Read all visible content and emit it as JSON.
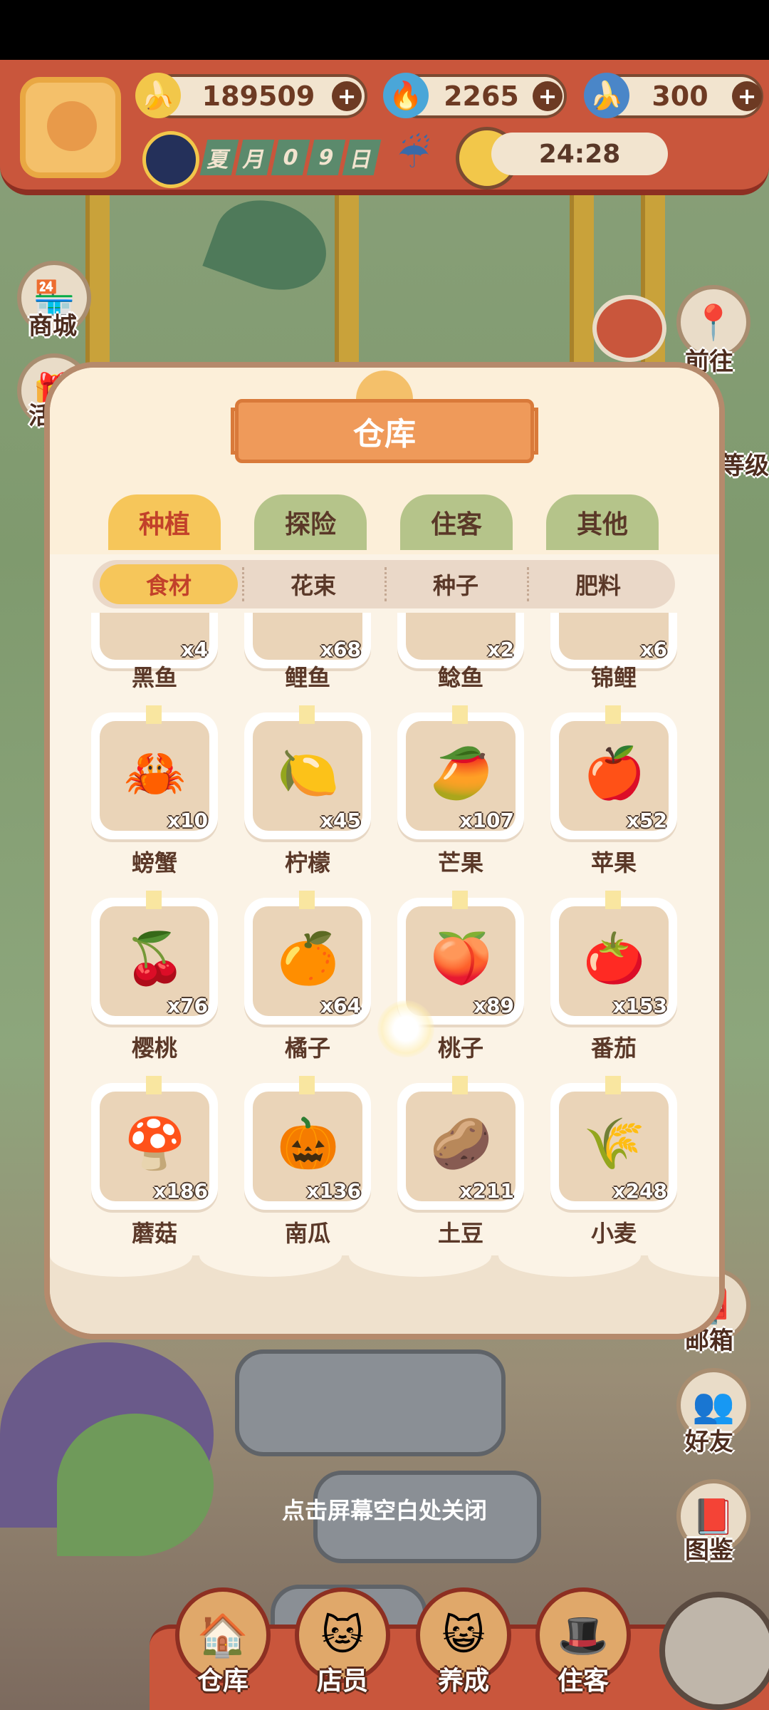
{
  "hud": {
    "resources": [
      {
        "icon": "banana-icon",
        "value": "189509"
      },
      {
        "icon": "blue-flame-icon",
        "value": "2265"
      },
      {
        "icon": "blue-banana-icon",
        "value": "300"
      }
    ],
    "date": {
      "season": "夏",
      "month_char": "月",
      "d1": "0",
      "d2": "9",
      "day_char": "日"
    },
    "timer": "24:28",
    "plus": "+"
  },
  "side_left": [
    {
      "label": "商城",
      "icon": "shop-icon"
    },
    {
      "label": "活动",
      "icon": "gift-icon"
    }
  ],
  "side_right": [
    {
      "label": "前往",
      "icon": "map-pin-icon"
    },
    {
      "label": "等级",
      "icon": "level-icon"
    },
    {
      "label": "邮箱",
      "icon": "mailbox-icon"
    },
    {
      "label": "好友",
      "icon": "friends-icon"
    },
    {
      "label": "图鉴",
      "icon": "book-icon"
    }
  ],
  "dialog": {
    "title": "仓库",
    "tabs": [
      "种植",
      "探险",
      "住客",
      "其他"
    ],
    "active_tab": 0,
    "subtabs": [
      "食材",
      "花束",
      "种子",
      "肥料"
    ],
    "active_subtab": 0,
    "partial_row": [
      {
        "name": "黑鱼",
        "qty": "x4"
      },
      {
        "name": "鲤鱼",
        "qty": "x68"
      },
      {
        "name": "鲶鱼",
        "qty": "x2"
      },
      {
        "name": "锦鲤",
        "qty": "x6"
      }
    ],
    "rows": [
      [
        {
          "name": "螃蟹",
          "qty": "x10",
          "icon": "crab-icon",
          "glyph": "🦀"
        },
        {
          "name": "柠檬",
          "qty": "x45",
          "icon": "lemon-icon",
          "glyph": "🍋"
        },
        {
          "name": "芒果",
          "qty": "x107",
          "icon": "mango-icon",
          "glyph": "🥭"
        },
        {
          "name": "苹果",
          "qty": "x52",
          "icon": "apple-icon",
          "glyph": "🍎"
        }
      ],
      [
        {
          "name": "樱桃",
          "qty": "x76",
          "icon": "cherry-icon",
          "glyph": "🍒"
        },
        {
          "name": "橘子",
          "qty": "x64",
          "icon": "tangerine-icon",
          "glyph": "🍊"
        },
        {
          "name": "桃子",
          "qty": "x89",
          "icon": "peach-icon",
          "glyph": "🍑"
        },
        {
          "name": "番茄",
          "qty": "x153",
          "icon": "tomato-icon",
          "glyph": "🍅"
        }
      ],
      [
        {
          "name": "蘑菇",
          "qty": "x186",
          "icon": "mushroom-icon",
          "glyph": "🍄"
        },
        {
          "name": "南瓜",
          "qty": "x136",
          "icon": "pumpkin-icon",
          "glyph": "🎃"
        },
        {
          "name": "土豆",
          "qty": "x211",
          "icon": "potato-icon",
          "glyph": "🥔"
        },
        {
          "name": "小麦",
          "qty": "x248",
          "icon": "wheat-icon",
          "glyph": "🌾"
        }
      ]
    ]
  },
  "close_hint": "点击屏幕空白处关闭",
  "bottom_nav": [
    {
      "label": "仓库",
      "icon": "warehouse-icon"
    },
    {
      "label": "店员",
      "icon": "cat-staff-icon"
    },
    {
      "label": "养成",
      "icon": "nurture-icon"
    },
    {
      "label": "住客",
      "icon": "guest-icon"
    }
  ]
}
